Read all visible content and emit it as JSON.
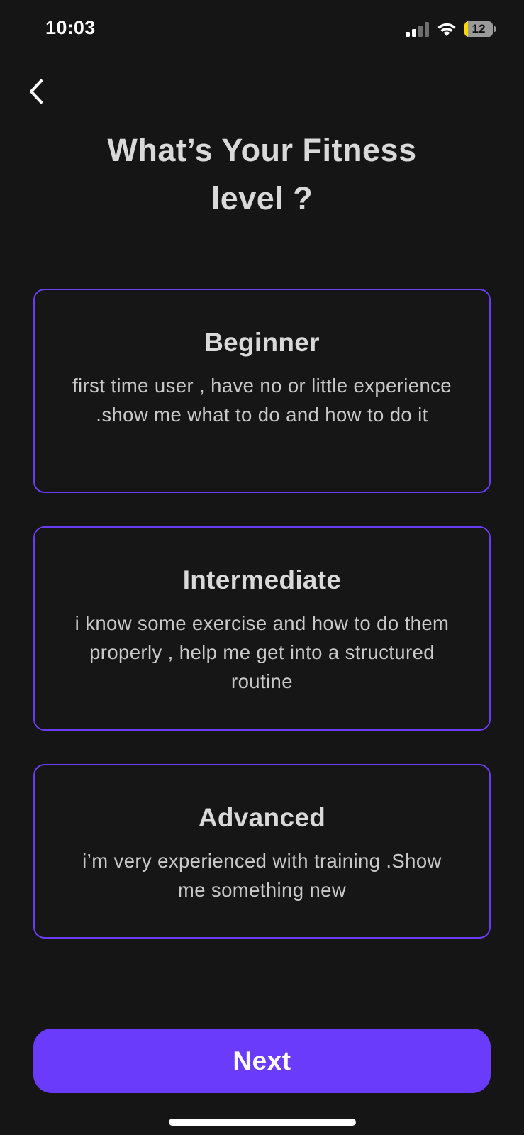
{
  "status_bar": {
    "time": "10:03",
    "battery_level": "12",
    "battery_fraction": 0.12,
    "battery_color": "#ffd60a",
    "signal_icon": "cellular-signal-icon",
    "wifi_icon": "wifi-icon"
  },
  "header": {
    "back_icon": "chevron-left-icon",
    "title_line1": "What’s Your Fitness",
    "title_line2": "level ?"
  },
  "options": [
    {
      "title": "Beginner",
      "description": "first time user , have no or little experience .show me what to do and how to do it"
    },
    {
      "title": "Intermediate",
      "description": "i know some exercise and how to do them properly , help me get into a structured routine"
    },
    {
      "title": "Advanced",
      "description": "i’m very experienced with training .Show me something new"
    }
  ],
  "next_button": {
    "label": "Next"
  },
  "colors": {
    "background": "#151515",
    "accent": "#6a3bfa",
    "card_border": "#6a3df2",
    "text": "#d9d9d9"
  }
}
